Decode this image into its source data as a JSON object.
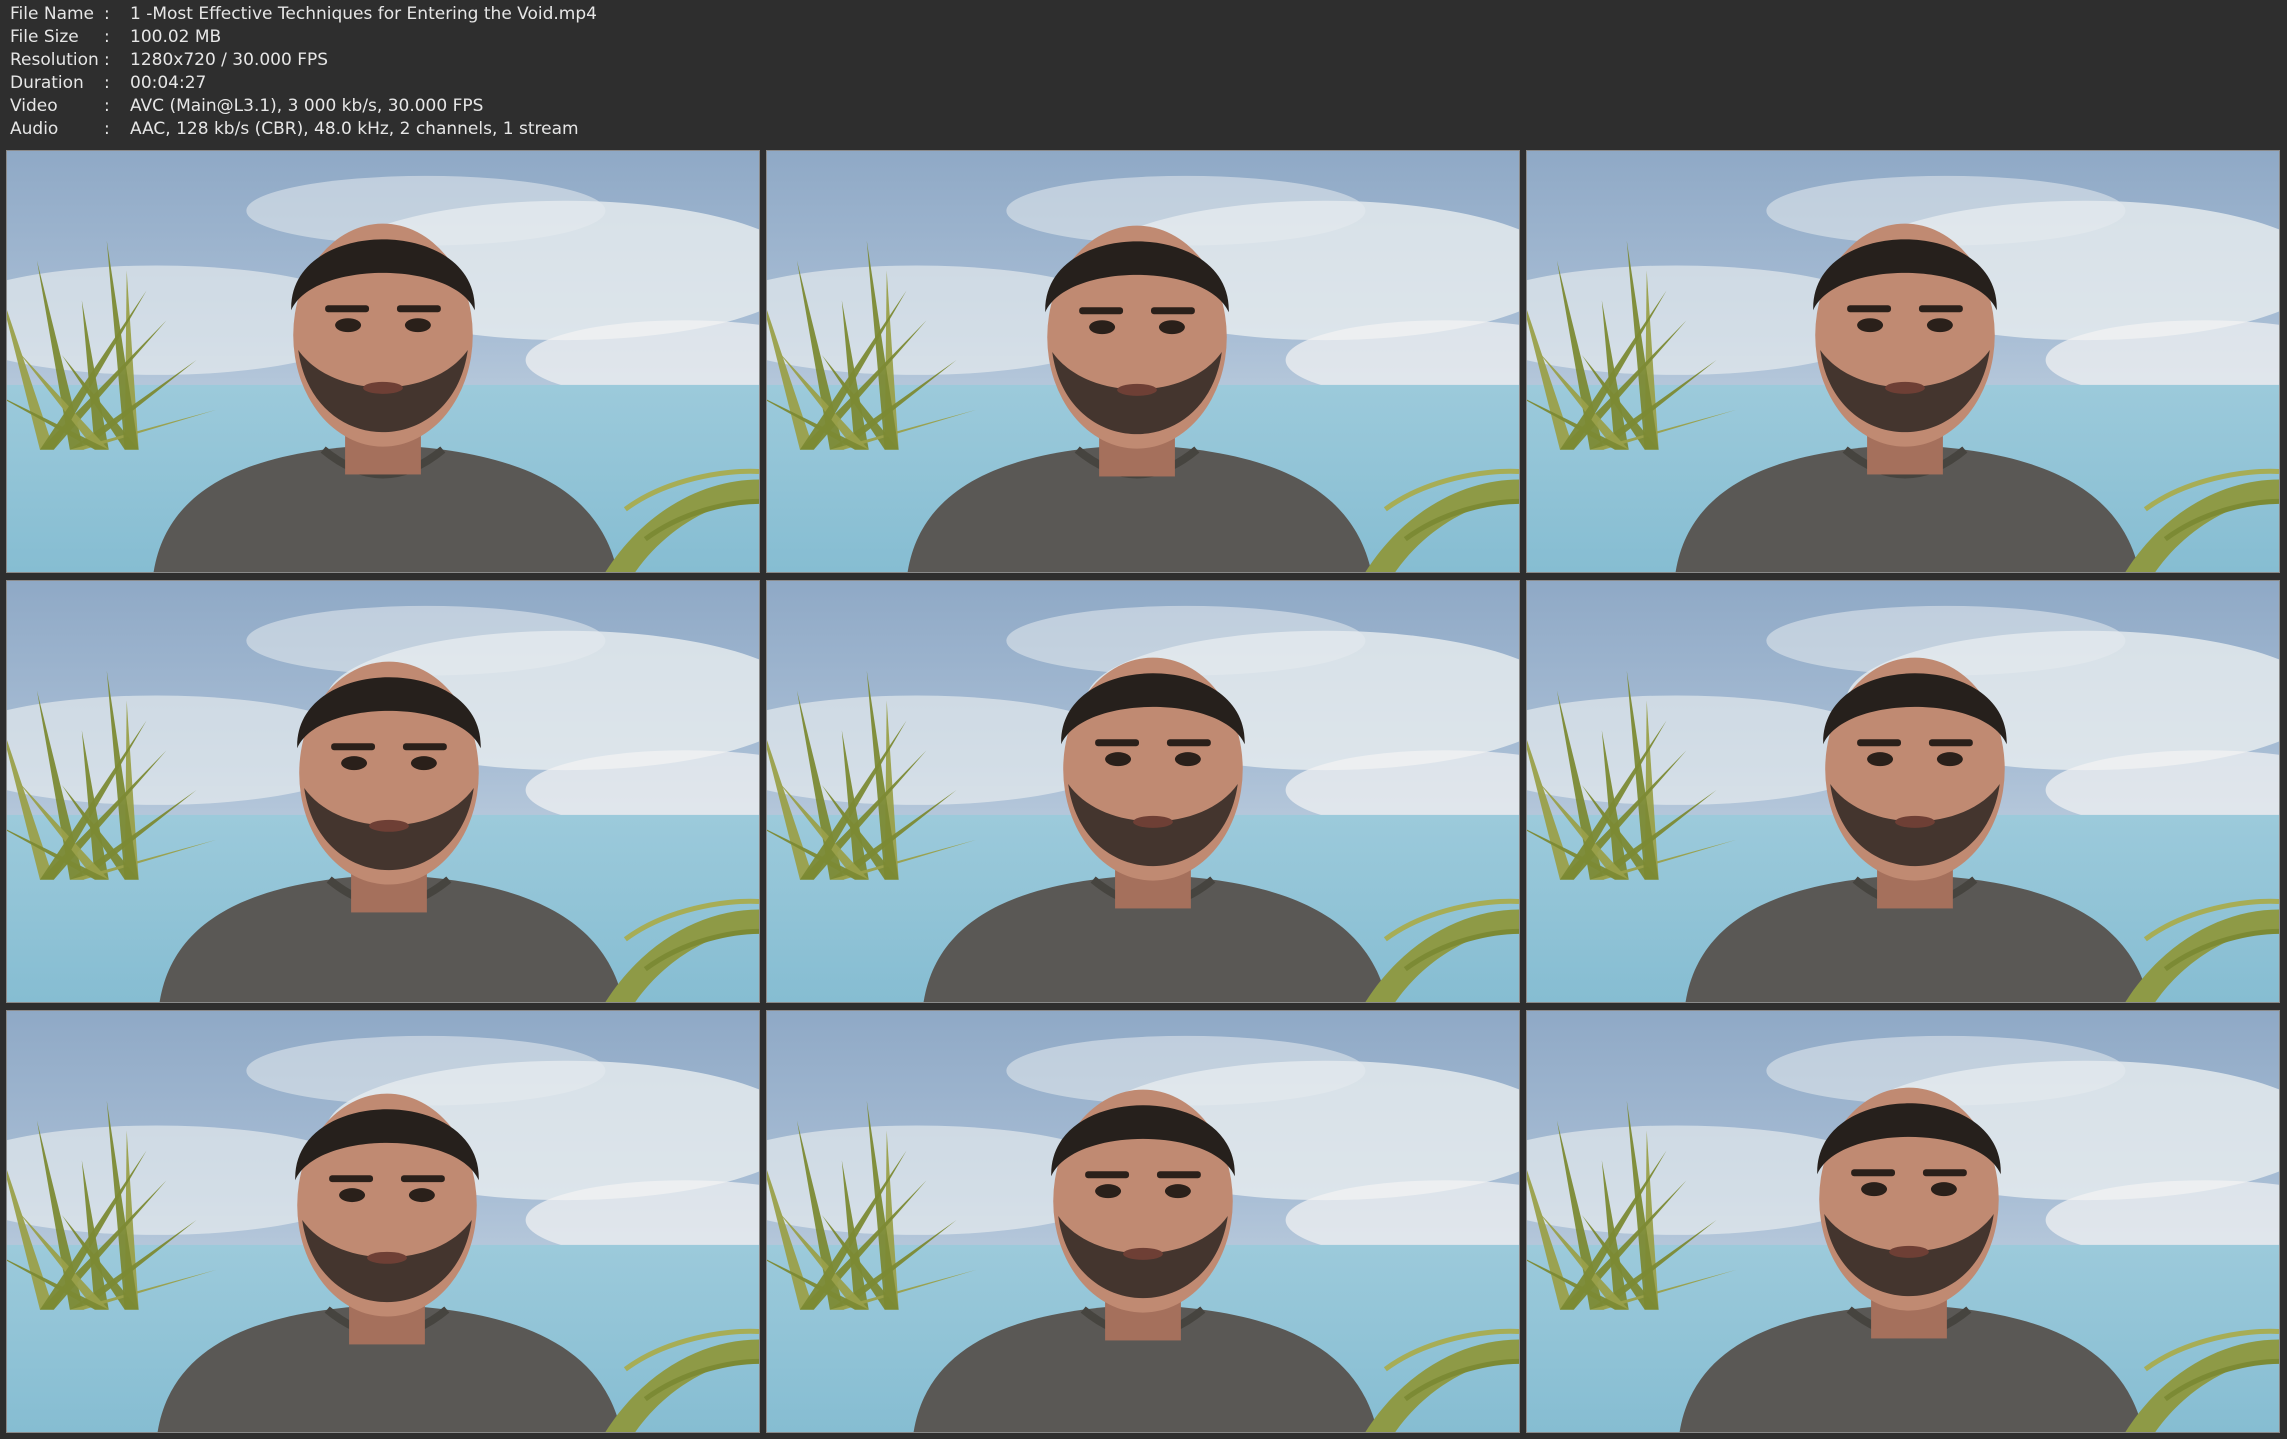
{
  "info": {
    "separator": ":",
    "rows": [
      {
        "label": "File Name",
        "value": "1 -Most Effective Techniques for Entering the Void.mp4"
      },
      {
        "label": "File Size",
        "value": "100.02 MB"
      },
      {
        "label": "Resolution",
        "value": "1280x720 / 30.000 FPS"
      },
      {
        "label": "Duration",
        "value": "00:04:27"
      },
      {
        "label": "Video",
        "value": "AVC (Main@L3.1), 3 000 kb/s, 30.000 FPS"
      },
      {
        "label": "Audio",
        "value": "AAC, 128 kb/s (CBR), 48.0 kHz, 2 channels, 1 stream"
      }
    ]
  },
  "colors": {
    "background": "#2e2e2e",
    "text": "#e6e6e6",
    "thumb_border": "#8a8a8a",
    "sky": "#aabfd6",
    "sea": "#86bdd2",
    "shirt": "#5a5855",
    "skin": "#c08a72",
    "hair": "#26201c",
    "plant": "#7c8a34"
  },
  "thumbnails": {
    "count": 9,
    "icon": "video-frame-icon"
  }
}
